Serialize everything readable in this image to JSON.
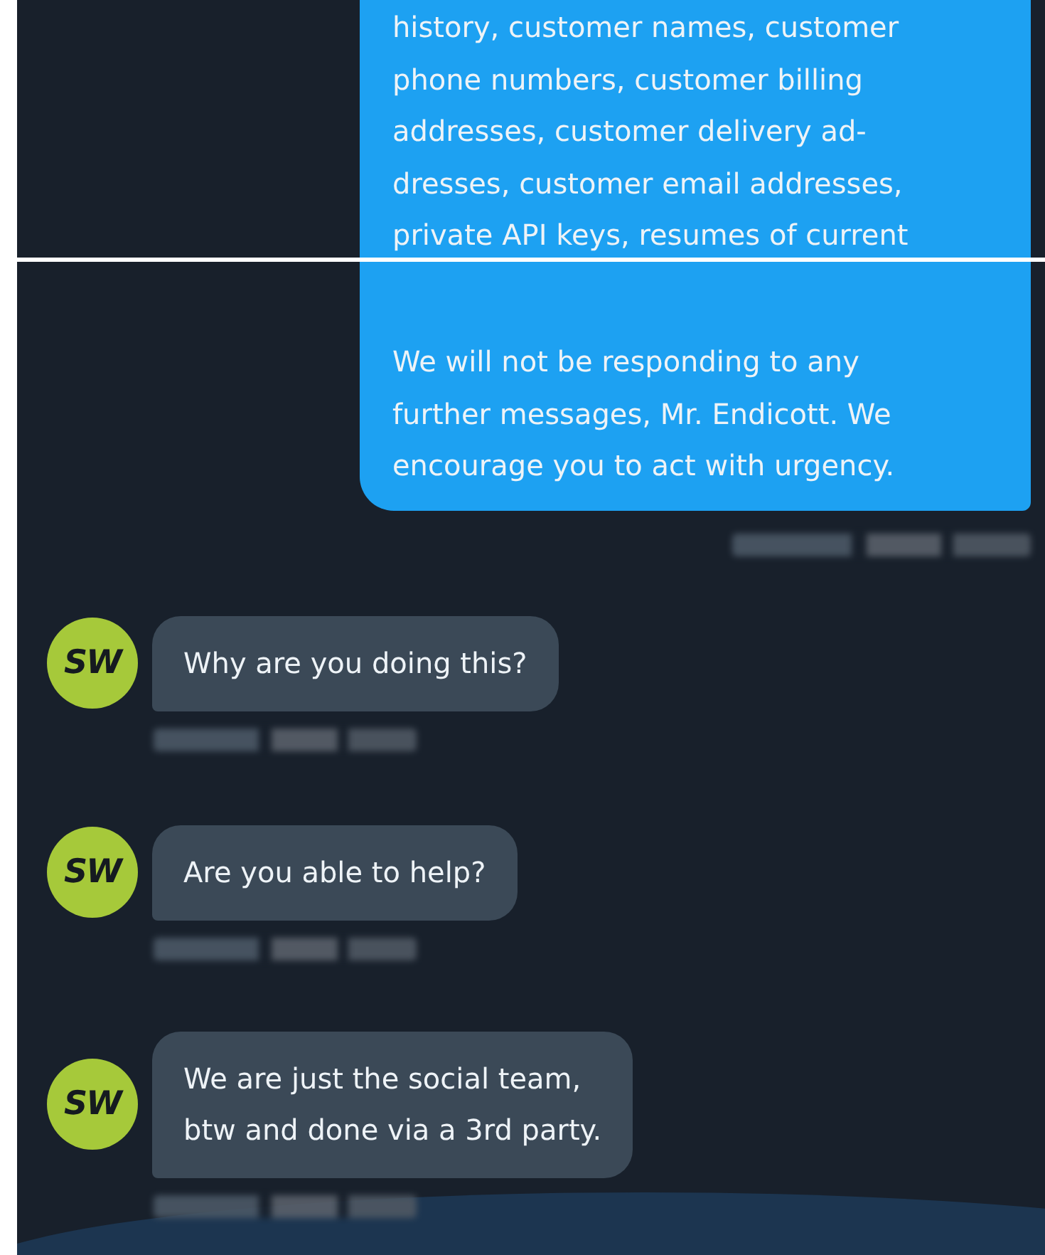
{
  "top_screenshot": {
    "sent_message_text": "history, customer names, customer\nphone numbers, customer billing\naddresses, customer delivery ad-\ndresses, customer email addresses,\nprivate API keys, resumes of current"
  },
  "bottom_screenshot": {
    "sent_message_text": "We will not be responding to any\nfurther messages, Mr. Endicott. We\nencourage you to act with urgency.",
    "received_messages": [
      {
        "avatar": "SW",
        "text": "Why are you doing this?"
      },
      {
        "avatar": "SW",
        "text": "Are you able to help?"
      },
      {
        "avatar": "SW",
        "text": "We are just the social team,\nbtw and done via a 3rd party."
      }
    ]
  }
}
